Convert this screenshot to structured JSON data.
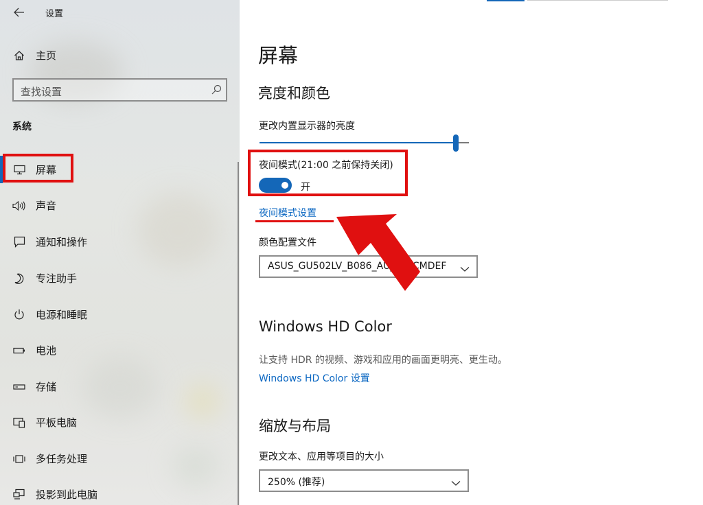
{
  "window": {
    "title": "设置",
    "back_icon": "back-arrow-icon"
  },
  "sidebar": {
    "home_label": "主页",
    "search_placeholder": "查找设置",
    "section": "系统",
    "items": [
      {
        "label": "屏幕",
        "icon": "monitor-icon",
        "selected": true
      },
      {
        "label": "声音",
        "icon": "speaker-icon"
      },
      {
        "label": "通知和操作",
        "icon": "notification-icon"
      },
      {
        "label": "专注助手",
        "icon": "moon-icon"
      },
      {
        "label": "电源和睡眠",
        "icon": "power-icon"
      },
      {
        "label": "电池",
        "icon": "battery-icon"
      },
      {
        "label": "存储",
        "icon": "storage-icon"
      },
      {
        "label": "平板电脑",
        "icon": "tablet-icon"
      },
      {
        "label": "多任务处理",
        "icon": "multitask-icon"
      },
      {
        "label": "投影到此电脑",
        "icon": "project-icon"
      }
    ]
  },
  "main": {
    "page_title": "屏幕",
    "brightness": {
      "heading": "亮度和颜色",
      "slider_label": "更改内置显示器的亮度",
      "slider_value_percent": 97
    },
    "night_light": {
      "label": "夜间模式(21:00 之前保持关闭)",
      "toggle_state": "开",
      "on": true,
      "settings_link": "夜间模式设置"
    },
    "color_profile": {
      "label": "颜色配置文件",
      "value": "ASUS_GU502LV_B086_AU_EB_CMDEF"
    },
    "hd_color": {
      "heading": "Windows HD Color",
      "description": "让支持 HDR 的视频、游戏和应用的画面更明亮、更生动。",
      "link": "Windows HD Color 设置"
    },
    "scale": {
      "heading": "缩放与布局",
      "label": "更改文本、应用等项目的大小",
      "value": "250% (推荐)"
    }
  },
  "annotation": {
    "color": "#e01010"
  },
  "colors": {
    "accent": "#1467b8",
    "link": "#0b67c2"
  }
}
